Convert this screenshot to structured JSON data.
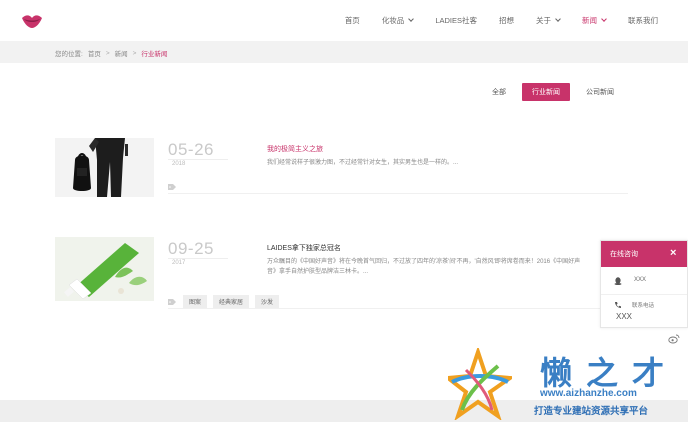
{
  "nav": {
    "items": [
      {
        "label": "首页",
        "dropdown": false,
        "active": false
      },
      {
        "label": "化妆品",
        "dropdown": true,
        "active": false
      },
      {
        "label": "LADIES社客",
        "dropdown": false,
        "active": false
      },
      {
        "label": "招想",
        "dropdown": false,
        "active": false
      },
      {
        "label": "关于",
        "dropdown": true,
        "active": false
      },
      {
        "label": "新闻",
        "dropdown": true,
        "active": true
      },
      {
        "label": "联系我们",
        "dropdown": false,
        "active": false
      }
    ]
  },
  "breadcrumb": {
    "prefix": "您的位置:",
    "items": [
      "首页",
      "新闻",
      "行业新闻"
    ],
    "separator": ">"
  },
  "tabs": [
    {
      "label": "全部",
      "active": false
    },
    {
      "label": "行业新闻",
      "active": true
    },
    {
      "label": "公司新闻",
      "active": false
    }
  ],
  "news": [
    {
      "date": "05-26",
      "year": "2018",
      "title": "我的极简主义之旅",
      "summary": "我们经常说样子很激力图，不过经常针对女生，其实男生也是一样的。...",
      "tags": []
    },
    {
      "date": "09-25",
      "year": "2017",
      "title": "LAIDES拿下独家总冠名",
      "summary": "万众瞩目的《中国好声音》将在今晚首气回归，不过放了四年的'凉茶'间'不再，'自然风'即将席卷而来！2016《中国好声音》拿手自然护肤型品牌洁三林卡。...",
      "tags": [
        "图案",
        "经典家居",
        "沙发"
      ]
    }
  ],
  "chat": {
    "title": "在线咨询",
    "qq": "XXX",
    "tel_label": "联系电话",
    "tel_value": "XXX"
  },
  "watermark": {
    "brand": "懒之才",
    "url": "www.aizhanzhe.com",
    "slogan": "打造专业建站资源共享平台"
  },
  "colors": {
    "accent": "#c8336a",
    "breadcrumb_bg": "#f2f2f2",
    "footer_bg": "#eeeeee",
    "watermark": "#3a7fc4"
  }
}
